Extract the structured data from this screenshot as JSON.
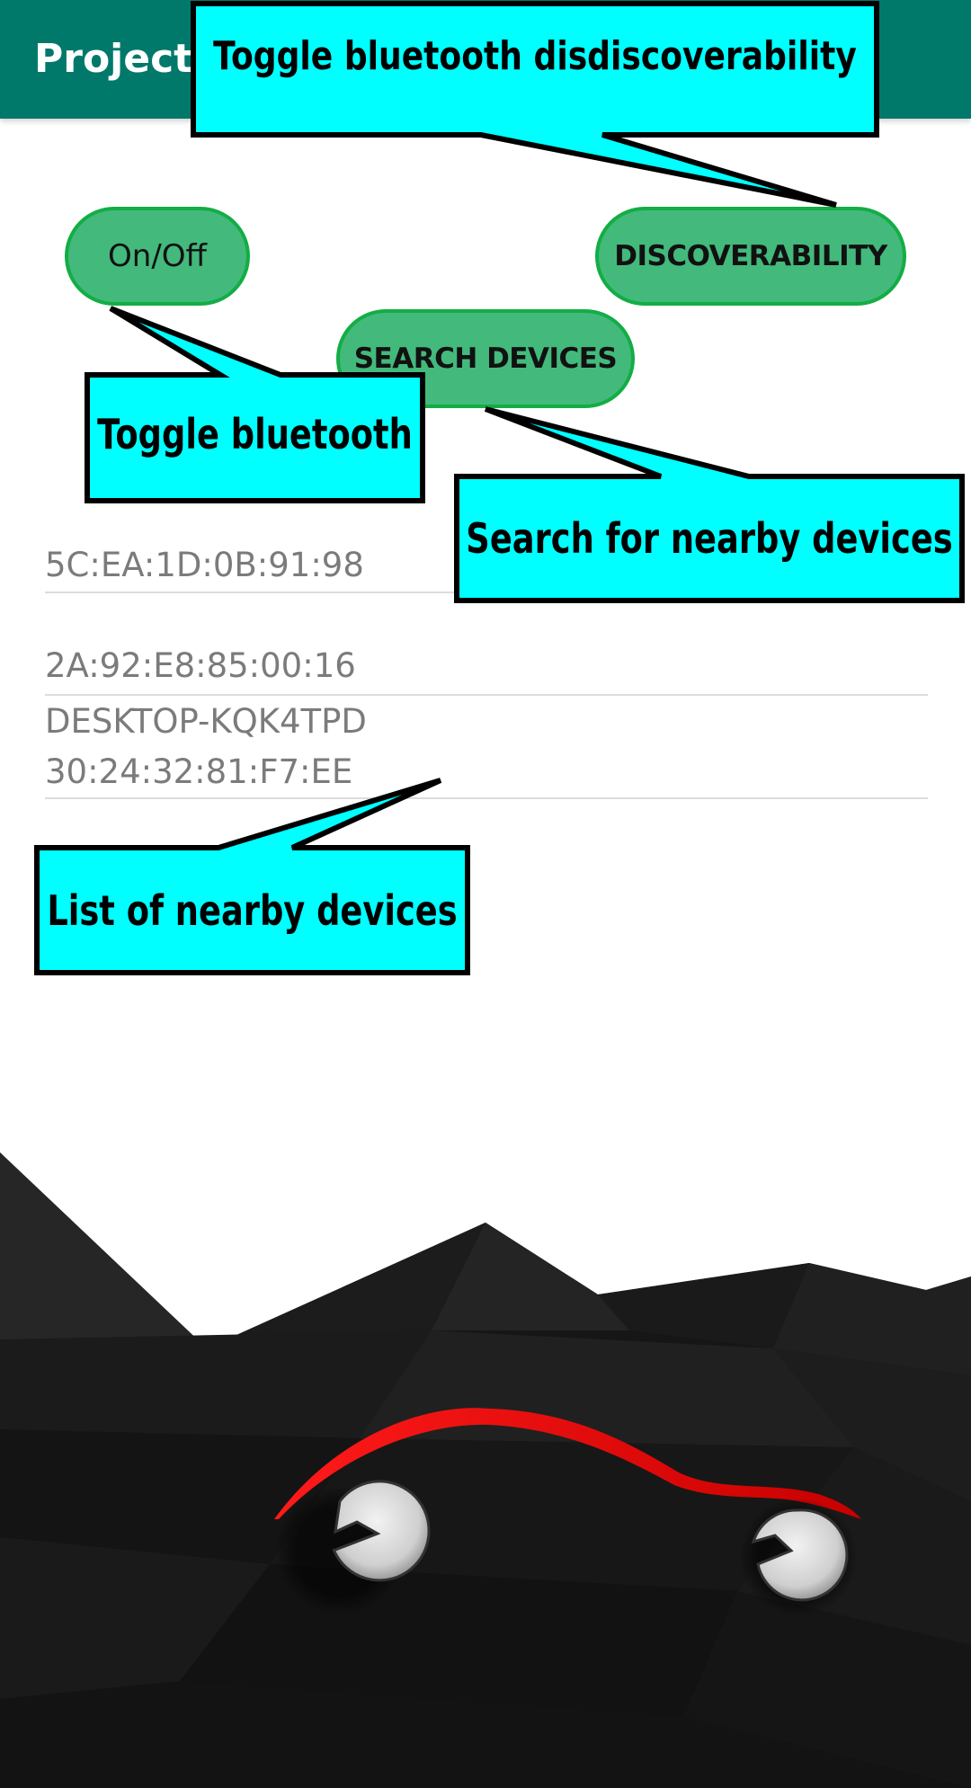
{
  "app": {
    "title": "Project"
  },
  "buttons": {
    "on_off_label": "On/Off",
    "discoverability_label": "DISCOVERABILITY",
    "search_label": "SEARCH DEVICES"
  },
  "devices": [
    {
      "name": "",
      "address": "5C:EA:1D:0B:91:98"
    },
    {
      "name": "",
      "address": "2A:92:E8:85:00:16"
    },
    {
      "name": "DESKTOP-KQK4TPD",
      "address": "30:24:32:81:F7:EE"
    }
  ],
  "annotations": {
    "discoverability": "Toggle bluetooth disdiscoverability",
    "bluetooth": "Toggle bluetooth",
    "search": "Search for nearby devices",
    "list": "List of nearby devices"
  },
  "colors": {
    "app_bar": "#00796b",
    "button_fill": "#43b97c",
    "button_border": "#13ad45",
    "callout_fill": "#00ffff",
    "callout_border": "#000000",
    "device_text": "#7b7b7b",
    "divider": "#dcdcdc",
    "car_accent": "#e00000",
    "mountain_dark": "#141414"
  },
  "icons": {
    "car_logo": "car-logo-icon"
  }
}
